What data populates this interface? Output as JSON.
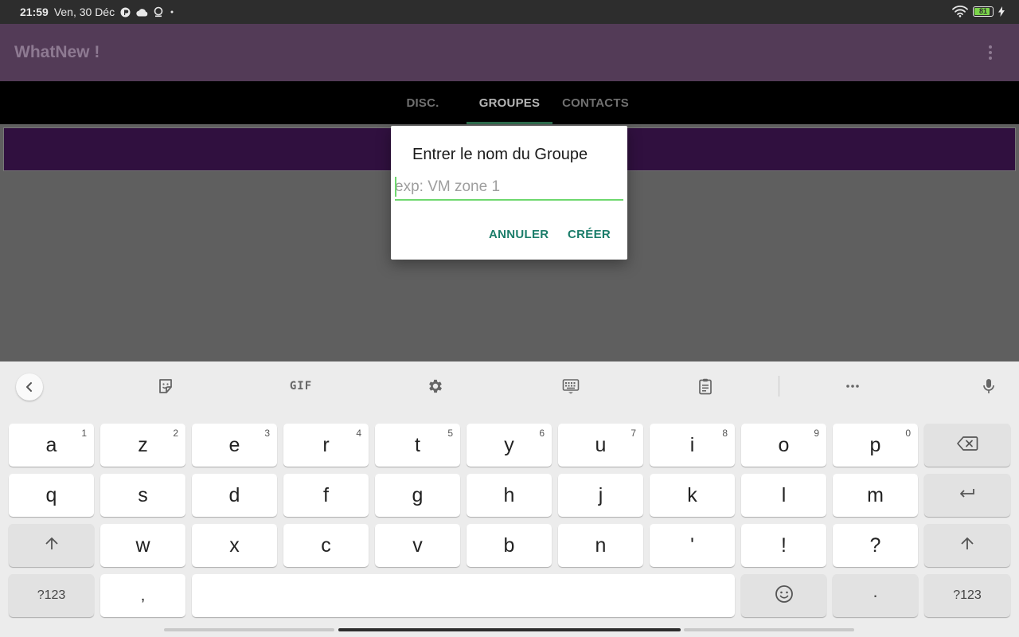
{
  "status_bar": {
    "time": "21:59",
    "date": "Ven, 30 Déc",
    "battery": "81"
  },
  "app": {
    "title": "WhatNew !"
  },
  "tabs": [
    {
      "label": "DISC.",
      "active": false
    },
    {
      "label": "GROUPES",
      "active": true
    },
    {
      "label": "CONTACTS",
      "active": false
    }
  ],
  "dialog": {
    "title": "Entrer le nom du Groupe",
    "input_value": "",
    "input_placeholder": "exp: VM zone 1",
    "cancel_label": "ANNULER",
    "create_label": "CRÉER"
  },
  "keyboard": {
    "toolbar": {
      "gif_label": "GIF"
    },
    "row1": [
      {
        "label": "a",
        "hint": "1"
      },
      {
        "label": "z",
        "hint": "2"
      },
      {
        "label": "e",
        "hint": "3"
      },
      {
        "label": "r",
        "hint": "4"
      },
      {
        "label": "t",
        "hint": "5"
      },
      {
        "label": "y",
        "hint": "6"
      },
      {
        "label": "u",
        "hint": "7"
      },
      {
        "label": "i",
        "hint": "8"
      },
      {
        "label": "o",
        "hint": "9"
      },
      {
        "label": "p",
        "hint": "0"
      }
    ],
    "row2": [
      "q",
      "s",
      "d",
      "f",
      "g",
      "h",
      "j",
      "k",
      "l",
      "m"
    ],
    "row3": [
      "w",
      "x",
      "c",
      "v",
      "b",
      "n",
      "'",
      "!",
      "?"
    ],
    "symbols_label": "?123",
    "comma_label": ",",
    "period_label": "·"
  },
  "colors": {
    "app_bar": "#533b57",
    "accent_green": "#6ed86e",
    "button_teal": "#1b7d6a",
    "group_banner": "#30103f"
  }
}
